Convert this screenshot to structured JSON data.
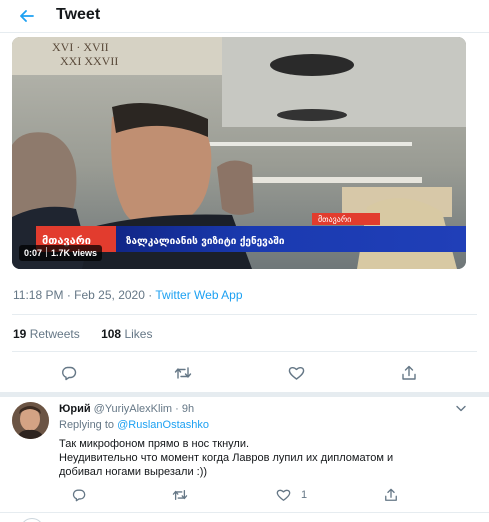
{
  "header": {
    "title": "Tweet",
    "back_icon": "arrow-left-icon",
    "accent": "#1da1f2"
  },
  "media": {
    "duration": "0:07",
    "views": "1.7K views",
    "banner_logo": "მთავარი",
    "banner_text": "ზალკალიანის ვიზიტი ქენევაში",
    "banner_top_label": "მთავარი",
    "wall_text_1": "XVI · XVII",
    "wall_text_2": "XXI  XXVII"
  },
  "tweet": {
    "time": "11:18 PM",
    "date": "Feb 25, 2020",
    "dot": "·",
    "source": "Twitter Web App"
  },
  "stats": {
    "retweets_count": "19",
    "retweets_label": "Retweets",
    "likes_count": "108",
    "likes_label": "Likes"
  },
  "actions": [
    "reply-icon",
    "retweet-icon",
    "like-icon",
    "share-icon"
  ],
  "reply": {
    "name": "Юрий",
    "handle": "@YuriyAlexKlim",
    "dot": "·",
    "time": "9h",
    "replying_prefix": "Replying to",
    "replying_to": "@RuslanOstashko",
    "text_lines": [
      "Так микрофоном прямо в нос ткнули.",
      "Неудивительно что момент когда Лавров лупил их дипломатом и",
      "добивал ногами вырезали :))"
    ],
    "like_count": "1"
  }
}
